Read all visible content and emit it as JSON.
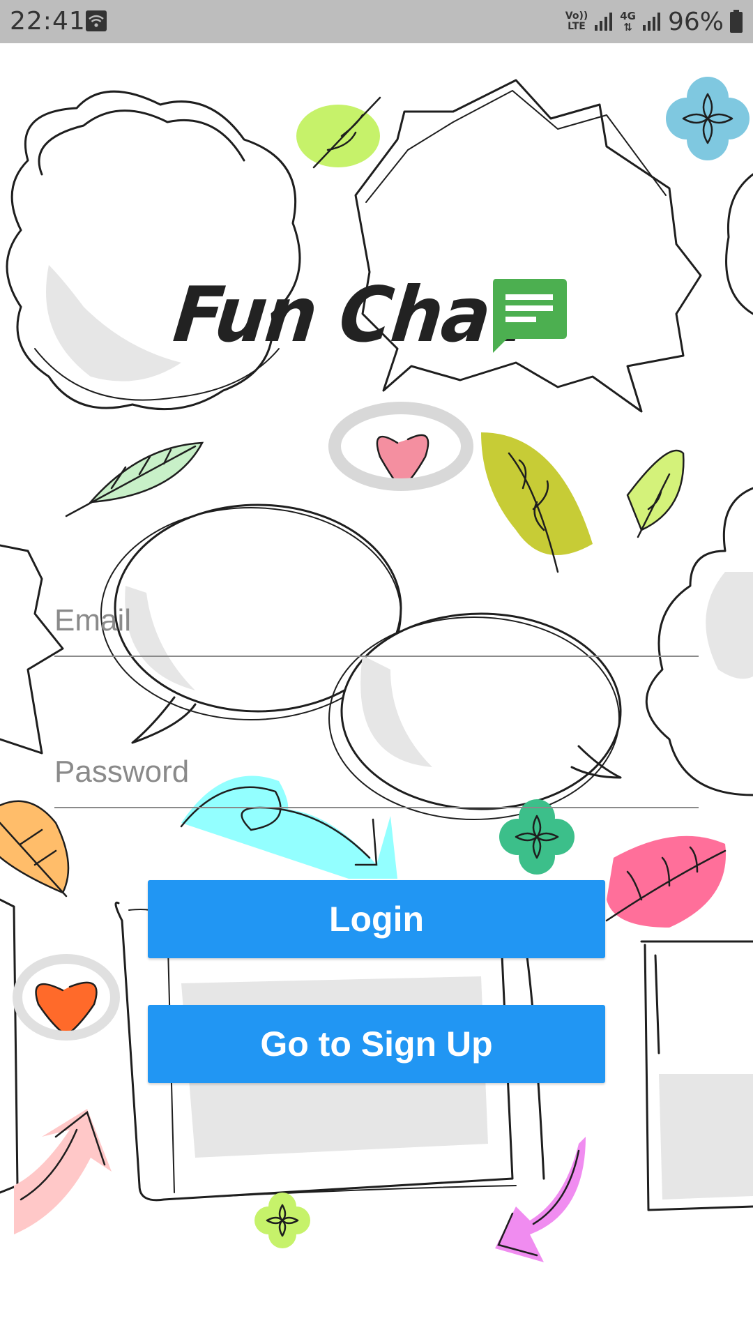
{
  "status_bar": {
    "time": "22:41",
    "volte_top": "Vo))",
    "volte_bottom": "LTE",
    "network_type": "4G",
    "battery_percent": "96%",
    "icons": [
      "wifi-icon",
      "signal-icon",
      "battery-icon"
    ]
  },
  "app": {
    "title": "Fun Chat",
    "logo_icon": "chat-message-icon",
    "logo_color": "#4caf50"
  },
  "form": {
    "email": {
      "placeholder": "Email",
      "value": ""
    },
    "password": {
      "placeholder": "Password",
      "value": ""
    }
  },
  "buttons": {
    "login_label": "Login",
    "signup_label": "Go to Sign Up",
    "color": "#2196f3"
  }
}
